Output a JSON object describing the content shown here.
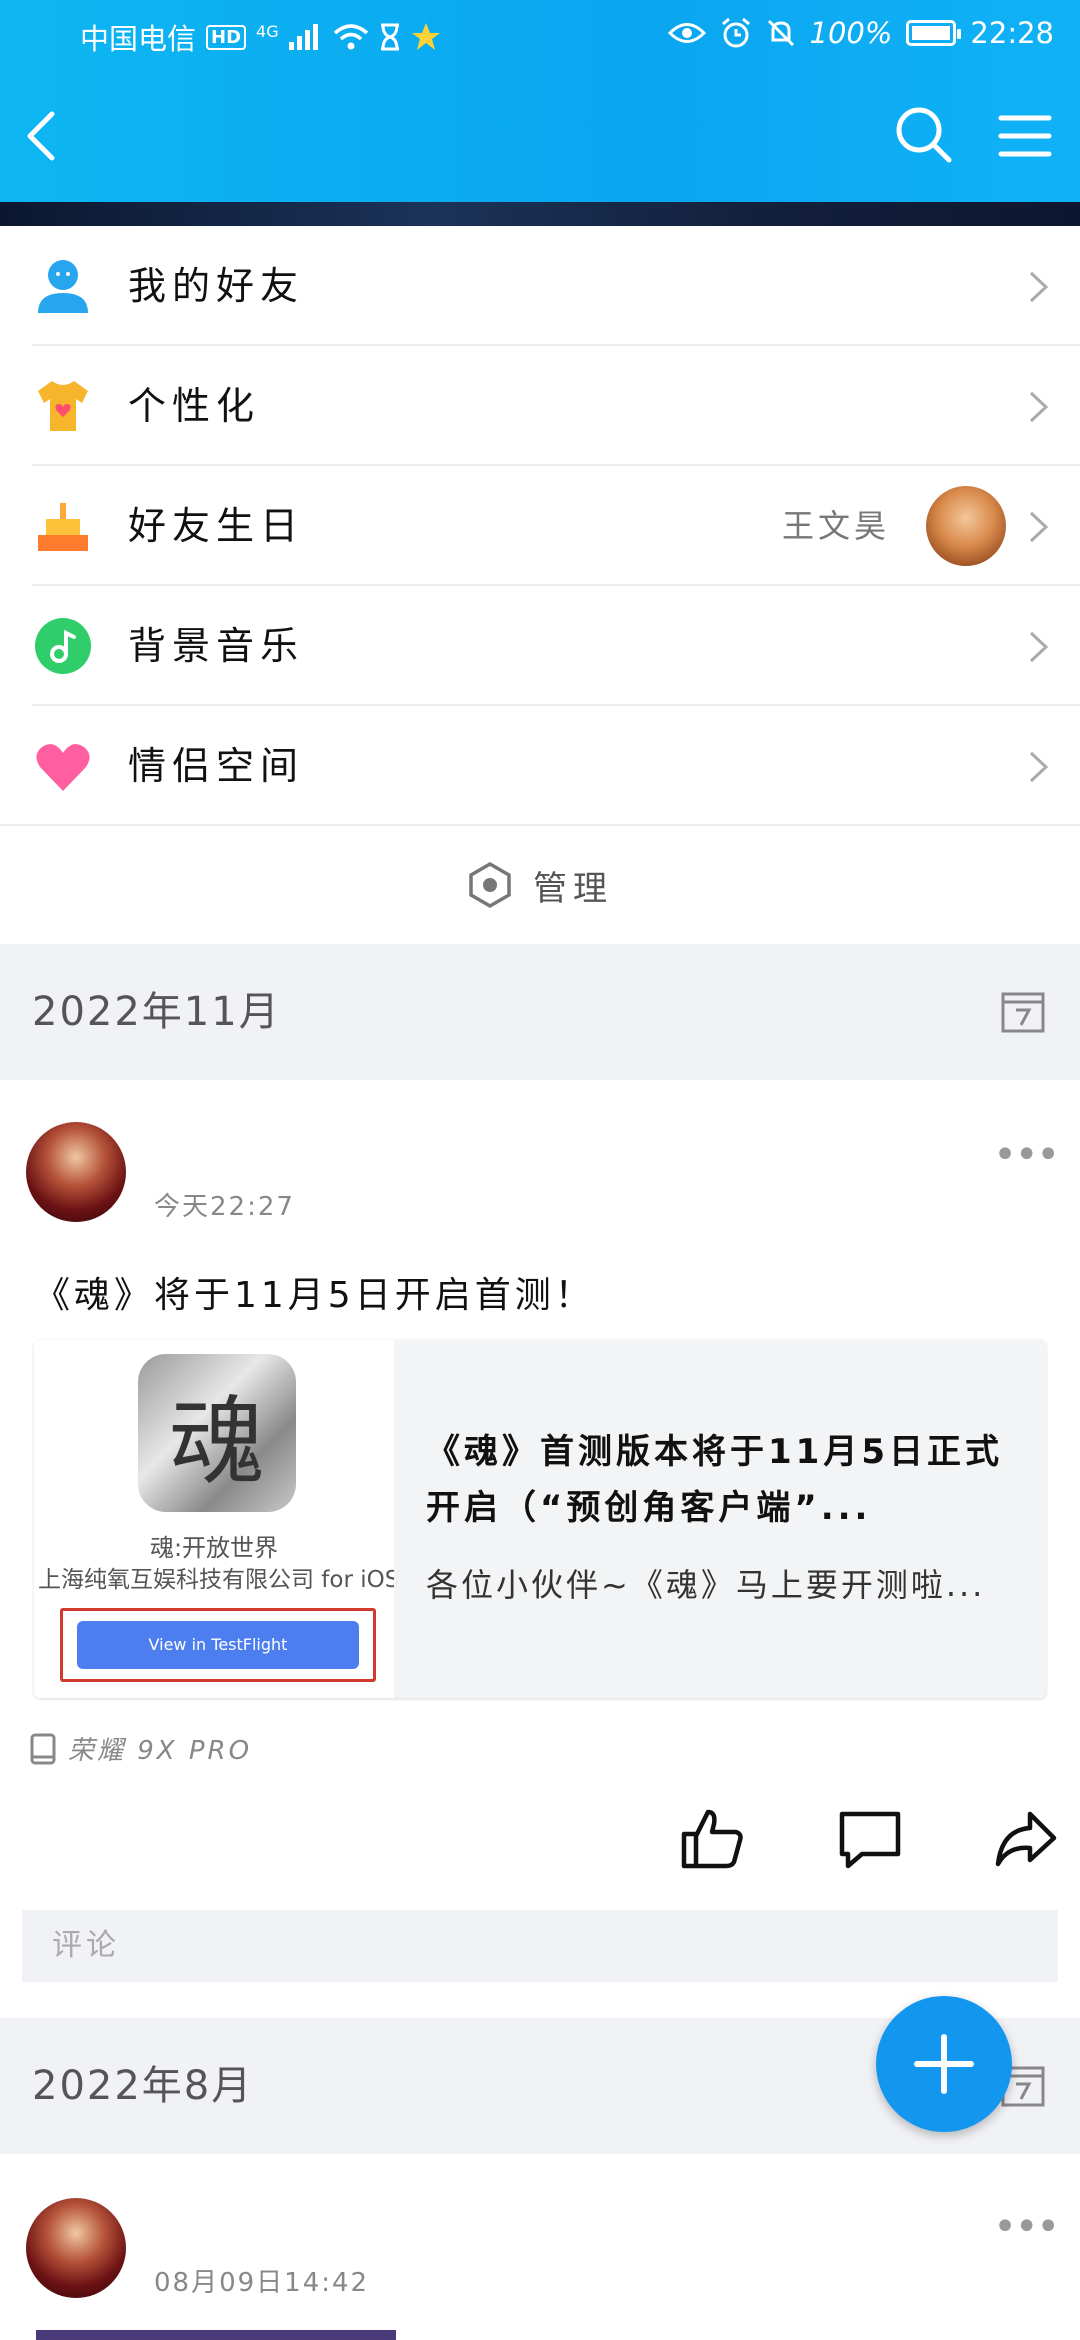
{
  "status_bar": {
    "carrier": "中国电信",
    "hd": "HD",
    "network": "4G",
    "battery": "100%",
    "battery_level": 1.0,
    "time": "22:28"
  },
  "header": {
    "back_icon": "back-chevron-icon",
    "search_icon": "search-icon",
    "menu_icon": "hamburger-menu-icon"
  },
  "menu": [
    {
      "label": "我的好友",
      "icon": "friend-icon",
      "color": "#27a6ef"
    },
    {
      "label": "个性化",
      "icon": "tshirt-icon",
      "color": "#f7b52c"
    },
    {
      "label": "好友生日",
      "icon": "cake-icon",
      "color": "#ff8f2e",
      "extra": "王文昊"
    },
    {
      "label": "背景音乐",
      "icon": "music-icon",
      "color": "#2fce6a"
    },
    {
      "label": "情侣空间",
      "icon": "heart-icon",
      "color": "#ff5fa0"
    }
  ],
  "manage_label": "管理",
  "months": [
    "2022年11月",
    "2022年8月"
  ],
  "post1": {
    "time": "今天22:27",
    "text": "《魂》将于11月5日开启首测！",
    "share": {
      "app_icon_char": "魂",
      "app_name": "魂:开放世界",
      "company": "上海纯氧互娱科技有限公司 for iOS",
      "button": "View in TestFlight",
      "title": "《魂》首测版本将于11月5日正式开启（“预创角客户端”...",
      "desc": "各位小伙伴~《魂》马上要开测啦..."
    },
    "device": "荣耀 9X PRO"
  },
  "comment_placeholder": "评论",
  "post2": {
    "time": "08月09日14:42"
  },
  "fab_icon": "plus-icon"
}
